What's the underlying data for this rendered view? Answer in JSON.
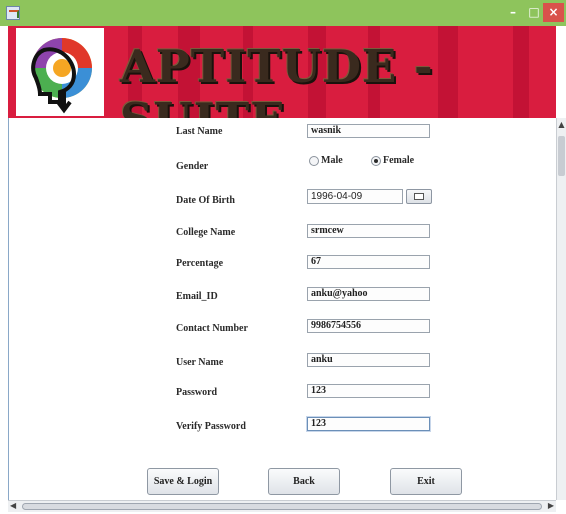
{
  "window": {
    "min_icon": "minimize-icon",
    "max_icon": "maximize-icon",
    "close_icon": "close-icon",
    "min_glyph": "–",
    "max_glyph": "□",
    "close_glyph": "×"
  },
  "banner": {
    "title": "APTITUDE - SUITE",
    "background": "#d91d3f",
    "logo_icon": "brain-head-logo-icon"
  },
  "form": {
    "last_name": {
      "label": "Last Name",
      "value": "wasnik"
    },
    "gender": {
      "label": "Gender",
      "options": [
        "Male",
        "Female"
      ],
      "selected": "Female"
    },
    "dob": {
      "label": "Date Of Birth",
      "value": "1996-04-09",
      "button_icon": "calendar-icon"
    },
    "college": {
      "label": "College Name",
      "value": "srmcew"
    },
    "percentage": {
      "label": "Percentage",
      "value": "67"
    },
    "email": {
      "label": "Email_ID",
      "value": "anku@yahoo"
    },
    "contact": {
      "label": "Contact Number",
      "value": "9986754556"
    },
    "username": {
      "label": "User Name",
      "value": "anku"
    },
    "password": {
      "label": "Password",
      "value": "123"
    },
    "verify_password": {
      "label": "Verify Password",
      "value": "123"
    }
  },
  "buttons": {
    "save_login": "Save & Login",
    "back": "Back",
    "exit": "Exit"
  },
  "colors": {
    "titlebar": "#8ec45c",
    "banner": "#d91d3f",
    "close_button": "#d9524b"
  }
}
